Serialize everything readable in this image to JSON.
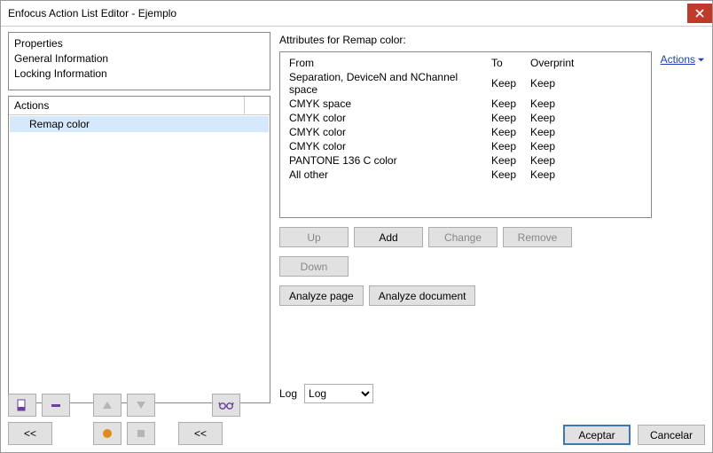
{
  "window": {
    "title": "Enfocus Action List Editor - Ejemplo"
  },
  "left": {
    "props_header": "Properties",
    "prop1": "General Information",
    "prop2": "Locking Information",
    "actions_header": "Actions",
    "action_item": "Remap color"
  },
  "attributes": {
    "title": "Attributes for Remap color:",
    "actions_link": "Actions",
    "headers": {
      "from": "From",
      "to": "To",
      "overprint": "Overprint"
    },
    "rows": [
      {
        "from": "Separation, DeviceN and NChannel space",
        "to": "Keep",
        "op": "Keep"
      },
      {
        "from": "CMYK space",
        "to": "Keep",
        "op": "Keep"
      },
      {
        "from": "CMYK color",
        "to": "Keep",
        "op": "Keep"
      },
      {
        "from": "CMYK color",
        "to": "Keep",
        "op": "Keep"
      },
      {
        "from": "CMYK color",
        "to": "Keep",
        "op": "Keep"
      },
      {
        "from": "PANTONE 136 C color",
        "to": "Keep",
        "op": "Keep"
      },
      {
        "from": "All other",
        "to": "Keep",
        "op": "Keep"
      }
    ],
    "buttons": {
      "up": "Up",
      "add": "Add",
      "change": "Change",
      "remove": "Remove",
      "down": "Down",
      "analyze_page": "Analyze page",
      "analyze_doc": "Analyze document"
    },
    "log_label": "Log",
    "log_value": "Log"
  },
  "footer": {
    "back1": "<<",
    "back2": "<<",
    "accept": "Aceptar",
    "cancel": "Cancelar"
  }
}
